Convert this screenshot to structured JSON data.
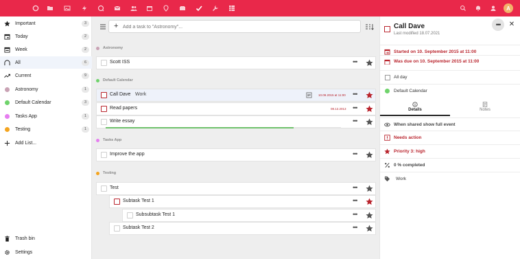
{
  "topbar": {
    "apps": [
      {
        "icon": "dashboard-icon",
        "active": false
      },
      {
        "icon": "files-icon",
        "active": false
      },
      {
        "icon": "photos-icon",
        "active": false
      },
      {
        "icon": "activity-icon",
        "active": false
      },
      {
        "icon": "talk-icon",
        "active": false
      },
      {
        "icon": "mail-icon",
        "active": false
      },
      {
        "icon": "contacts-icon",
        "active": false
      },
      {
        "icon": "calendar-icon",
        "active": false
      },
      {
        "icon": "maps-icon",
        "active": false
      },
      {
        "icon": "deck-icon",
        "active": false
      },
      {
        "icon": "tasks-icon",
        "active": true
      },
      {
        "icon": "settings-icon",
        "active": false
      },
      {
        "icon": "table-icon",
        "active": false
      }
    ],
    "right_icons": [
      "search-icon",
      "notifications-icon",
      "contacts-menu-icon"
    ],
    "avatar": "A",
    "brand_color": "#e9284a"
  },
  "sidebar": {
    "items": [
      {
        "label": "Important",
        "count": "3",
        "icon": "star-icon"
      },
      {
        "label": "Today",
        "count": "2",
        "icon": "calendar-today-icon"
      },
      {
        "label": "Week",
        "count": "2",
        "icon": "calendar-week-icon"
      },
      {
        "label": "All",
        "count": "6",
        "icon": "all-icon"
      },
      {
        "label": "Current",
        "count": "9",
        "icon": "trend-icon"
      },
      {
        "label": "Astronomy",
        "count": "1",
        "color": "#c9a2b4"
      },
      {
        "label": "Default Calendar",
        "count": "3",
        "color": "#6fd36b"
      },
      {
        "label": "Tasks App",
        "count": "1",
        "color": "#e67ef0"
      },
      {
        "label": "Testing",
        "count": "1",
        "color": "#f4a41f"
      }
    ],
    "add_list": "Add List...",
    "trash": "Trash bin",
    "settings": "Settings"
  },
  "main": {
    "add_placeholder": "Add a task to \"Astronomy\"...",
    "sections": [
      {
        "name": "Astronomy",
        "color": "#c9a2b4",
        "tasks": [
          {
            "title": "Scott ISS"
          }
        ]
      },
      {
        "name": "Default Calendar",
        "color": "#6fd36b",
        "tasks": [
          {
            "title": "Call Dave",
            "tag": "Work",
            "due": "10.09.2015 at 11:00"
          },
          {
            "title": "Read papers",
            "due": "08.12.2013"
          },
          {
            "title": "Write essay",
            "progress": 0.8
          }
        ]
      },
      {
        "name": "Tasks App",
        "color": "#e67ef0",
        "tasks": [
          {
            "title": "Improve the app"
          }
        ]
      },
      {
        "name": "Testing",
        "color": "#f4a41f",
        "tasks": [
          {
            "title": "Test"
          },
          {
            "title": "Subtask Test 1"
          },
          {
            "title": "Subsubtask Test 1"
          },
          {
            "title": "Subtask Test 2"
          }
        ]
      }
    ],
    "more_glyph": "•••"
  },
  "details": {
    "title": "Call Dave",
    "last_modified": "Last modified 18.07.2021",
    "more_glyph": "•••",
    "close_glyph": "✕",
    "start": "Started on 10. September 2015 at 11:00",
    "due": "Was due on 10. September 2015 at 11:00",
    "all_day": "All day",
    "calendar": "Default Calendar",
    "tabs": [
      "Details",
      "Notes"
    ],
    "visibility": "When shared show full event",
    "status": "Needs action",
    "priority": "Priority 3: high",
    "completed": "0 % completed",
    "tags": "Work",
    "accent_red": "#b9242d"
  }
}
